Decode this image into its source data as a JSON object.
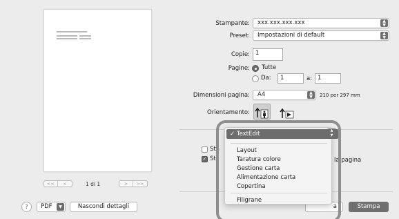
{
  "preview": {
    "page_counter": "1 di 1",
    "nav_first": "<<",
    "nav_prev": "<",
    "nav_next": ">",
    "nav_last": ">>"
  },
  "settings": {
    "printer_label": "Stampante:",
    "printer_value": "xxx.xxx.xxx.xxx",
    "preset_label": "Preset:",
    "preset_value": "Impostazioni di default",
    "copies_label": "Copie:",
    "copies_value": "1",
    "pages_label": "Pagine:",
    "pages_all": "Tutte",
    "pages_from": "Da:",
    "pages_from_value": "1",
    "pages_to": "a:",
    "pages_to_value": "1",
    "paper_size_label": "Dimensioni pagina:",
    "paper_size_value": "A4",
    "paper_size_dims": "210 per 297 mm",
    "orientation_label": "Orientamento:",
    "partial_label_1": "Sta",
    "partial_label_2": "Sti",
    "partial_label_3": "la pagina"
  },
  "menu": {
    "selected": "TextEdit",
    "items": [
      "Layout",
      "Taratura colore",
      "Gestione carta",
      "Alimentazione carta",
      "Copertina"
    ],
    "last_item": "Filigrane"
  },
  "bottom": {
    "help": "?",
    "pdf": "PDF",
    "hide_details": "Nascondi dettagli",
    "cancel_partial": "a",
    "print": "Stampa"
  },
  "colors": {
    "background": "#ececec",
    "selected_gray": "#6d6d6d",
    "highlight_ring": "#8e8e8e"
  }
}
